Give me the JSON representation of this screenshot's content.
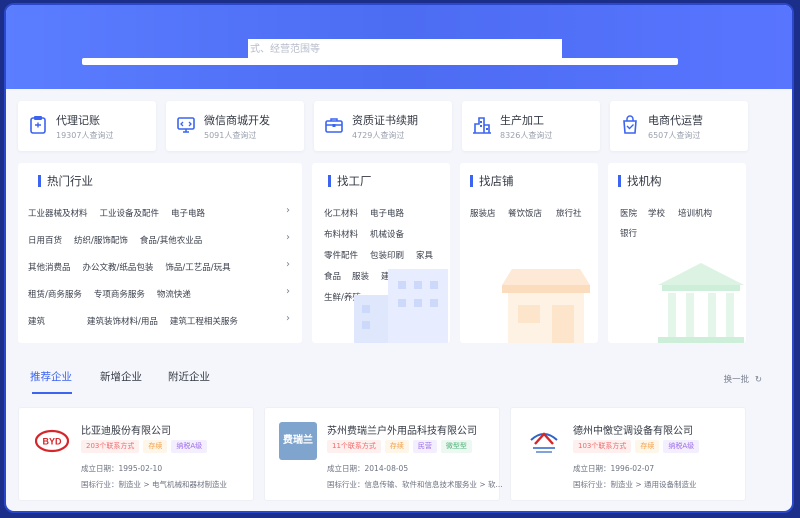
{
  "search": {
    "partial_text": "式、经营范围等"
  },
  "services": [
    {
      "title": "代理记账",
      "sub": "19307人查询过",
      "icon": "ledger-icon"
    },
    {
      "title": "微信商城开发",
      "sub": "5091人查询过",
      "icon": "monitor-code-icon"
    },
    {
      "title": "资质证书续期",
      "sub": "4729人查询过",
      "icon": "briefcase-icon"
    },
    {
      "title": "生产加工",
      "sub": "8326人查询过",
      "icon": "factory-icon"
    },
    {
      "title": "电商代运营",
      "sub": "6507人查询过",
      "icon": "shopping-bag-icon"
    }
  ],
  "hot_industry": {
    "title": "热门行业",
    "rows": [
      [
        "工业器械及材料",
        "工业设备及配件",
        "电子电路"
      ],
      [
        "日用百货",
        "纺织/服饰配饰",
        "食品/其他农业品"
      ],
      [
        "其他消费品",
        "办公文教/纸品包装",
        "饰品/工艺品/玩具"
      ],
      [
        "租赁/商务服务",
        "专项商务服务",
        "物流快递"
      ],
      [
        "建筑",
        "建筑装饰材料/用品",
        "建筑工程相关服务"
      ]
    ]
  },
  "factory": {
    "title": "找工厂",
    "rows": [
      [
        "化工材料",
        "电子电路"
      ],
      [
        "布料材料",
        "机械设备"
      ],
      [
        "零件配件",
        "包装印刷",
        "家具"
      ],
      [
        "食品",
        "服装",
        "建材"
      ],
      [
        "生鲜/养殖"
      ]
    ]
  },
  "shop": {
    "title": "找店铺",
    "rows": [
      [
        "服装店",
        "餐饮饭店",
        "旅行社"
      ]
    ]
  },
  "org": {
    "title": "找机构",
    "rows": [
      [
        "医院",
        "学校",
        "培训机构"
      ],
      [
        "银行"
      ]
    ]
  },
  "tabs": {
    "items": [
      "推荐企业",
      "新增企业",
      "附近企业"
    ],
    "refresh": "换一批"
  },
  "companies": [
    {
      "name": "比亚迪股份有限公司",
      "logo_text": "BYD",
      "badges": [
        {
          "text": "203个联系方式",
          "color": "red"
        },
        {
          "text": "存续",
          "color": "orange"
        },
        {
          "text": "纳税A级",
          "color": "purple"
        }
      ],
      "date": "成立日期：1995-02-10",
      "industry": "国标行业：制造业 > 电气机械和器材制造业"
    },
    {
      "name": "苏州费瑞兰户外用品科技有限公司",
      "logo_text": "费瑞兰",
      "badges": [
        {
          "text": "11个联系方式",
          "color": "red"
        },
        {
          "text": "存续",
          "color": "orange"
        },
        {
          "text": "民营",
          "color": "purple"
        },
        {
          "text": "微型型",
          "color": "green"
        }
      ],
      "date": "成立日期：2014-08-05",
      "industry": "国标行业：信息传输、软件和信息技术服务业 > 软..."
    },
    {
      "name": "德州中憿空调设备有限公司",
      "logo_text": "",
      "badges": [
        {
          "text": "103个联系方式",
          "color": "red"
        },
        {
          "text": "存续",
          "color": "orange"
        },
        {
          "text": "纳税A级",
          "color": "purple"
        }
      ],
      "date": "成立日期：1996-02-07",
      "industry": "国标行业：制造业 > 通用设备制造业"
    }
  ]
}
